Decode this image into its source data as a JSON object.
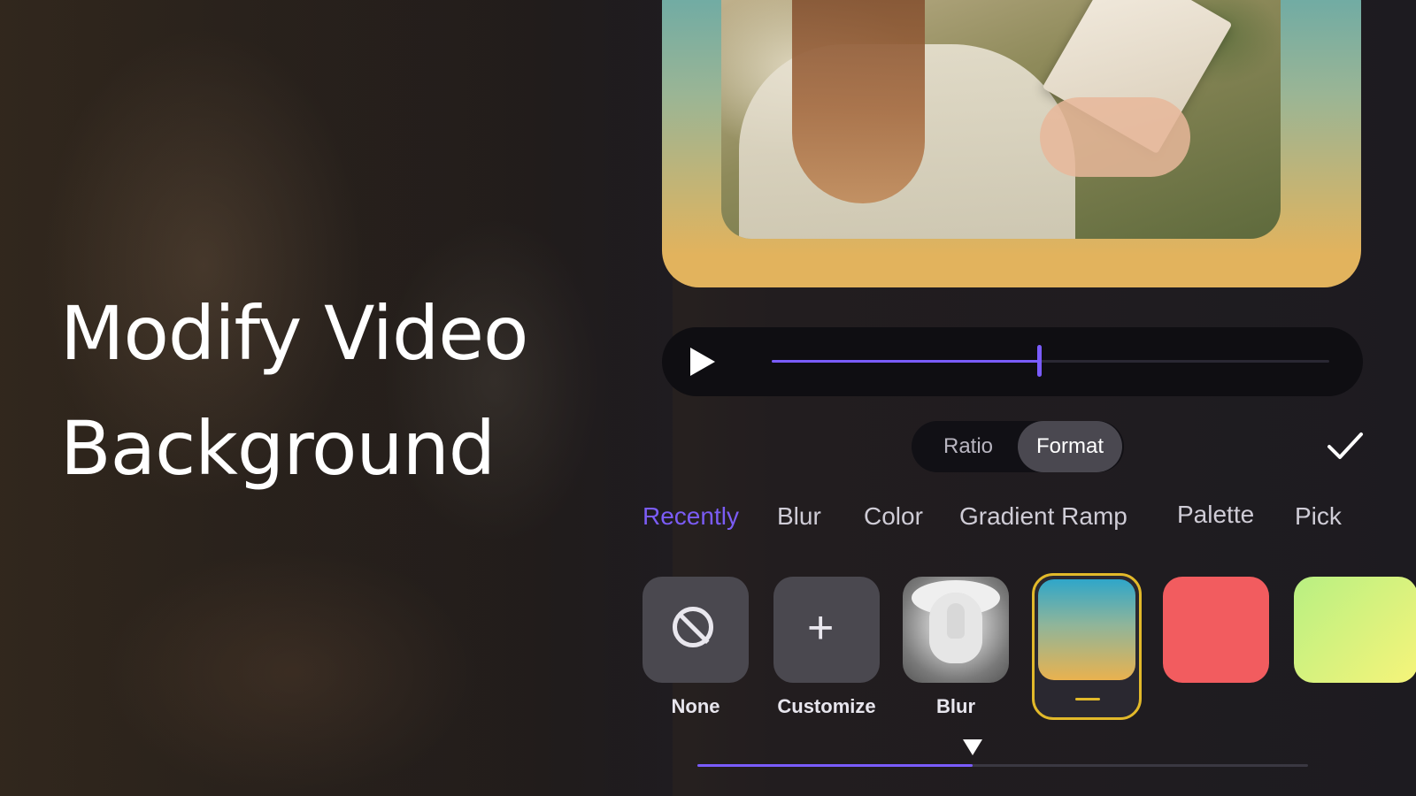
{
  "headline": {
    "line1": "Modify Video",
    "line2": "Background"
  },
  "player": {
    "progress": 0.48
  },
  "segmented": {
    "options": [
      "Ratio",
      "Format"
    ],
    "selected": "Format"
  },
  "tabs": [
    {
      "label": "Recently",
      "active": true
    },
    {
      "label": "Blur",
      "active": false
    },
    {
      "label": "Color",
      "active": false
    },
    {
      "label": "Gradient Ramp",
      "active": false
    },
    {
      "label": "Palette",
      "active": false
    },
    {
      "label": "Pick",
      "active": false
    }
  ],
  "swatches": [
    {
      "label": "None",
      "icon": "no-entry-icon"
    },
    {
      "label": "Customize",
      "icon": "plus-icon"
    },
    {
      "label": "Blur",
      "icon": "photo-thumbnail"
    },
    {
      "label": "",
      "selected": true
    },
    {
      "label": "",
      "color": "#f25c5f"
    },
    {
      "label": "",
      "color": "#c8f27e"
    }
  ],
  "colors": {
    "accent": "#7a5cff",
    "selection_border": "#e2b92a"
  },
  "scroll": {
    "progress": 0.45
  }
}
